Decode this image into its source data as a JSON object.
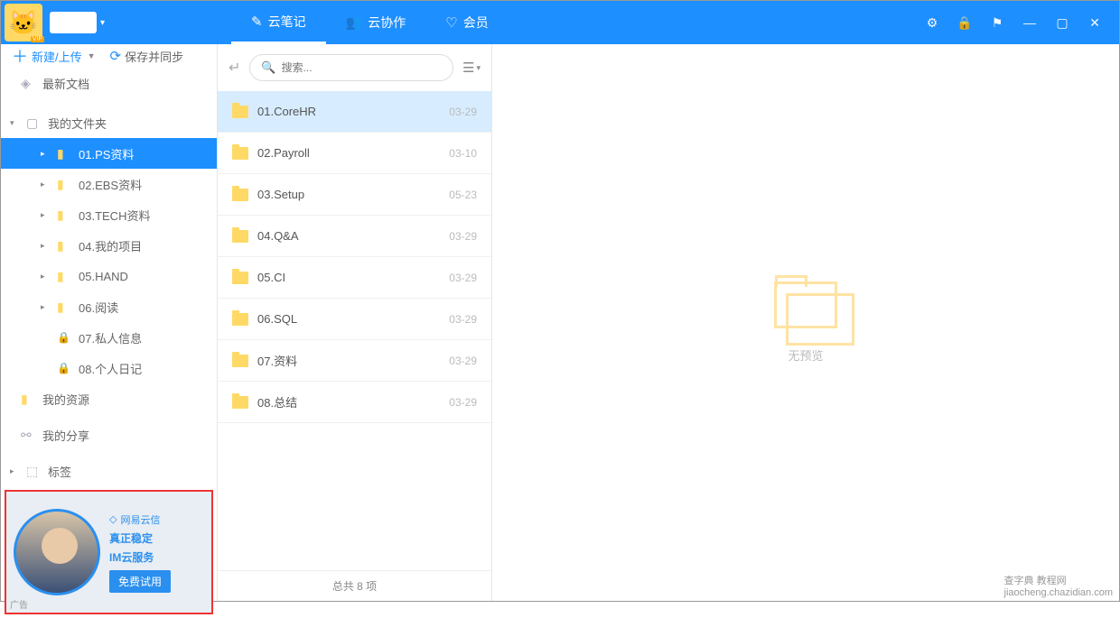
{
  "header": {
    "vip_badge": "VIP",
    "tabs": [
      {
        "icon": "✎",
        "label": "云笔记",
        "active": true
      },
      {
        "icon": "👥",
        "label": "云协作",
        "active": false
      },
      {
        "icon": "♡",
        "label": "会员",
        "active": false
      }
    ]
  },
  "toolbar": {
    "new_label": "新建/上传",
    "sync_label": "保存并同步"
  },
  "sidebar": {
    "recent": "最新文档",
    "my_folders": "我的文件夹",
    "my_resources": "我的资源",
    "my_shares": "我的分享",
    "tags": "标签",
    "tree": [
      {
        "label": "01.PS资料",
        "selected": true,
        "type": "folder"
      },
      {
        "label": "02.EBS资料",
        "type": "folder"
      },
      {
        "label": "03.TECH资料",
        "type": "folder"
      },
      {
        "label": "04.我的项目",
        "type": "folder"
      },
      {
        "label": "05.HAND",
        "type": "folder"
      },
      {
        "label": "06.阅读",
        "type": "folder"
      },
      {
        "label": "07.私人信息",
        "type": "lock"
      },
      {
        "label": "08.个人日记",
        "type": "lock"
      }
    ]
  },
  "ad": {
    "brand": "网易云信",
    "line1": "真正稳定",
    "line2": "IM云服务",
    "cta": "免费试用",
    "badge": "广告"
  },
  "search": {
    "placeholder": "搜索..."
  },
  "files": [
    {
      "name": "01.CoreHR",
      "date": "03-29",
      "selected": true
    },
    {
      "name": "02.Payroll",
      "date": "03-10"
    },
    {
      "name": "03.Setup",
      "date": "05-23"
    },
    {
      "name": "04.Q&A",
      "date": "03-29"
    },
    {
      "name": "05.CI",
      "date": "03-29"
    },
    {
      "name": "06.SQL",
      "date": "03-29"
    },
    {
      "name": "07.资料",
      "date": "03-29"
    },
    {
      "name": "08.总结",
      "date": "03-29"
    }
  ],
  "footer": {
    "total": "总共 8 项"
  },
  "preview": {
    "empty": "无预览"
  },
  "watermark": {
    "line1": "查字典 教程网",
    "line2": "jiaocheng.chazidian.com"
  }
}
